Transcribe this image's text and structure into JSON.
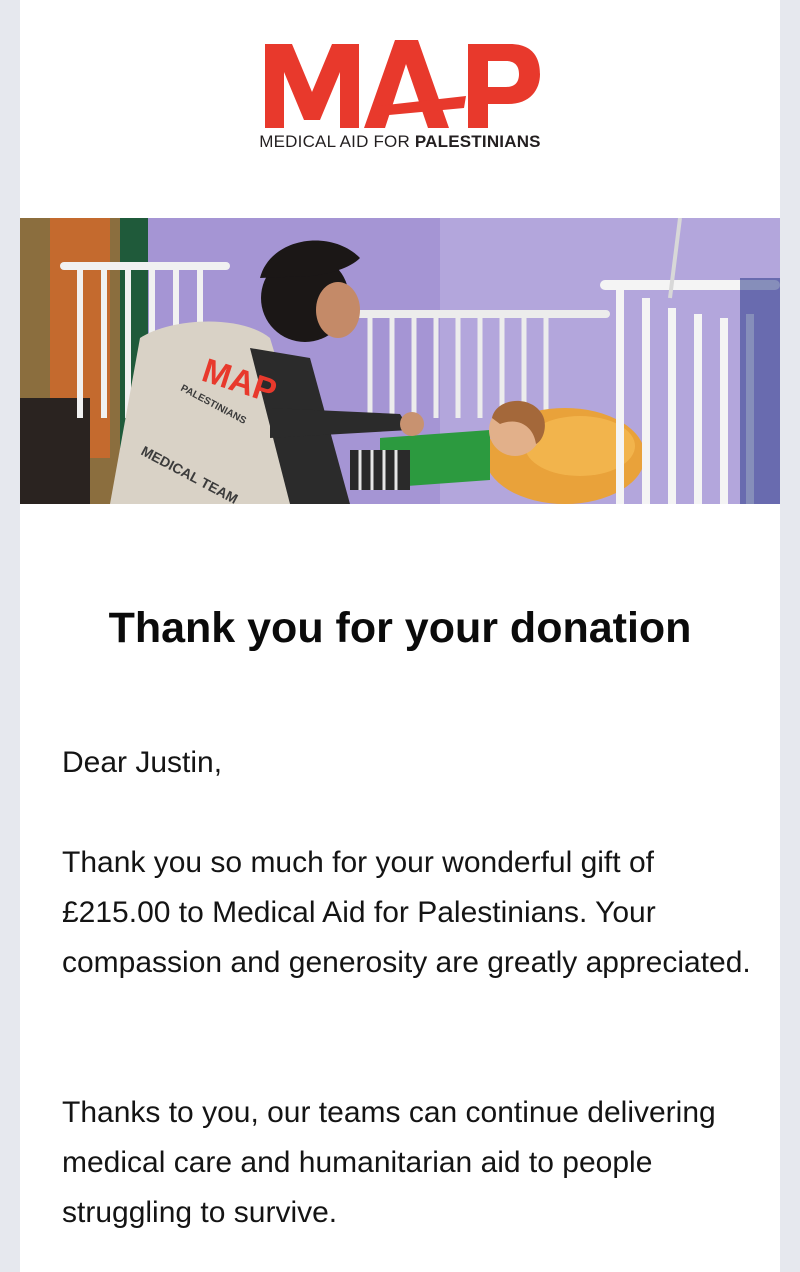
{
  "logo": {
    "wordmark": "MAP",
    "tagline_regular": "MEDICAL AID FOR ",
    "tagline_bold": "PALESTINIANS",
    "brand_color": "#e8392c"
  },
  "hero_image": {
    "vest_text_logo": "MAP",
    "vest_text_org": "PALESTINIANS",
    "vest_text_team": "MEDICAL TEAM"
  },
  "email": {
    "heading": "Thank you for your donation",
    "greeting": "Dear Justin,",
    "paragraph_1": "Thank you so much for your wonderful gift of £215.00 to Medical Aid for Palestinians. Your compassion and generosity are greatly appreciated.",
    "paragraph_2": "Thanks to you, our teams can continue delivering medical care and humanitarian aid to people struggling to survive."
  },
  "colors": {
    "page_background": "#e6e8ee",
    "card_background": "#ffffff",
    "text": "#141414"
  }
}
